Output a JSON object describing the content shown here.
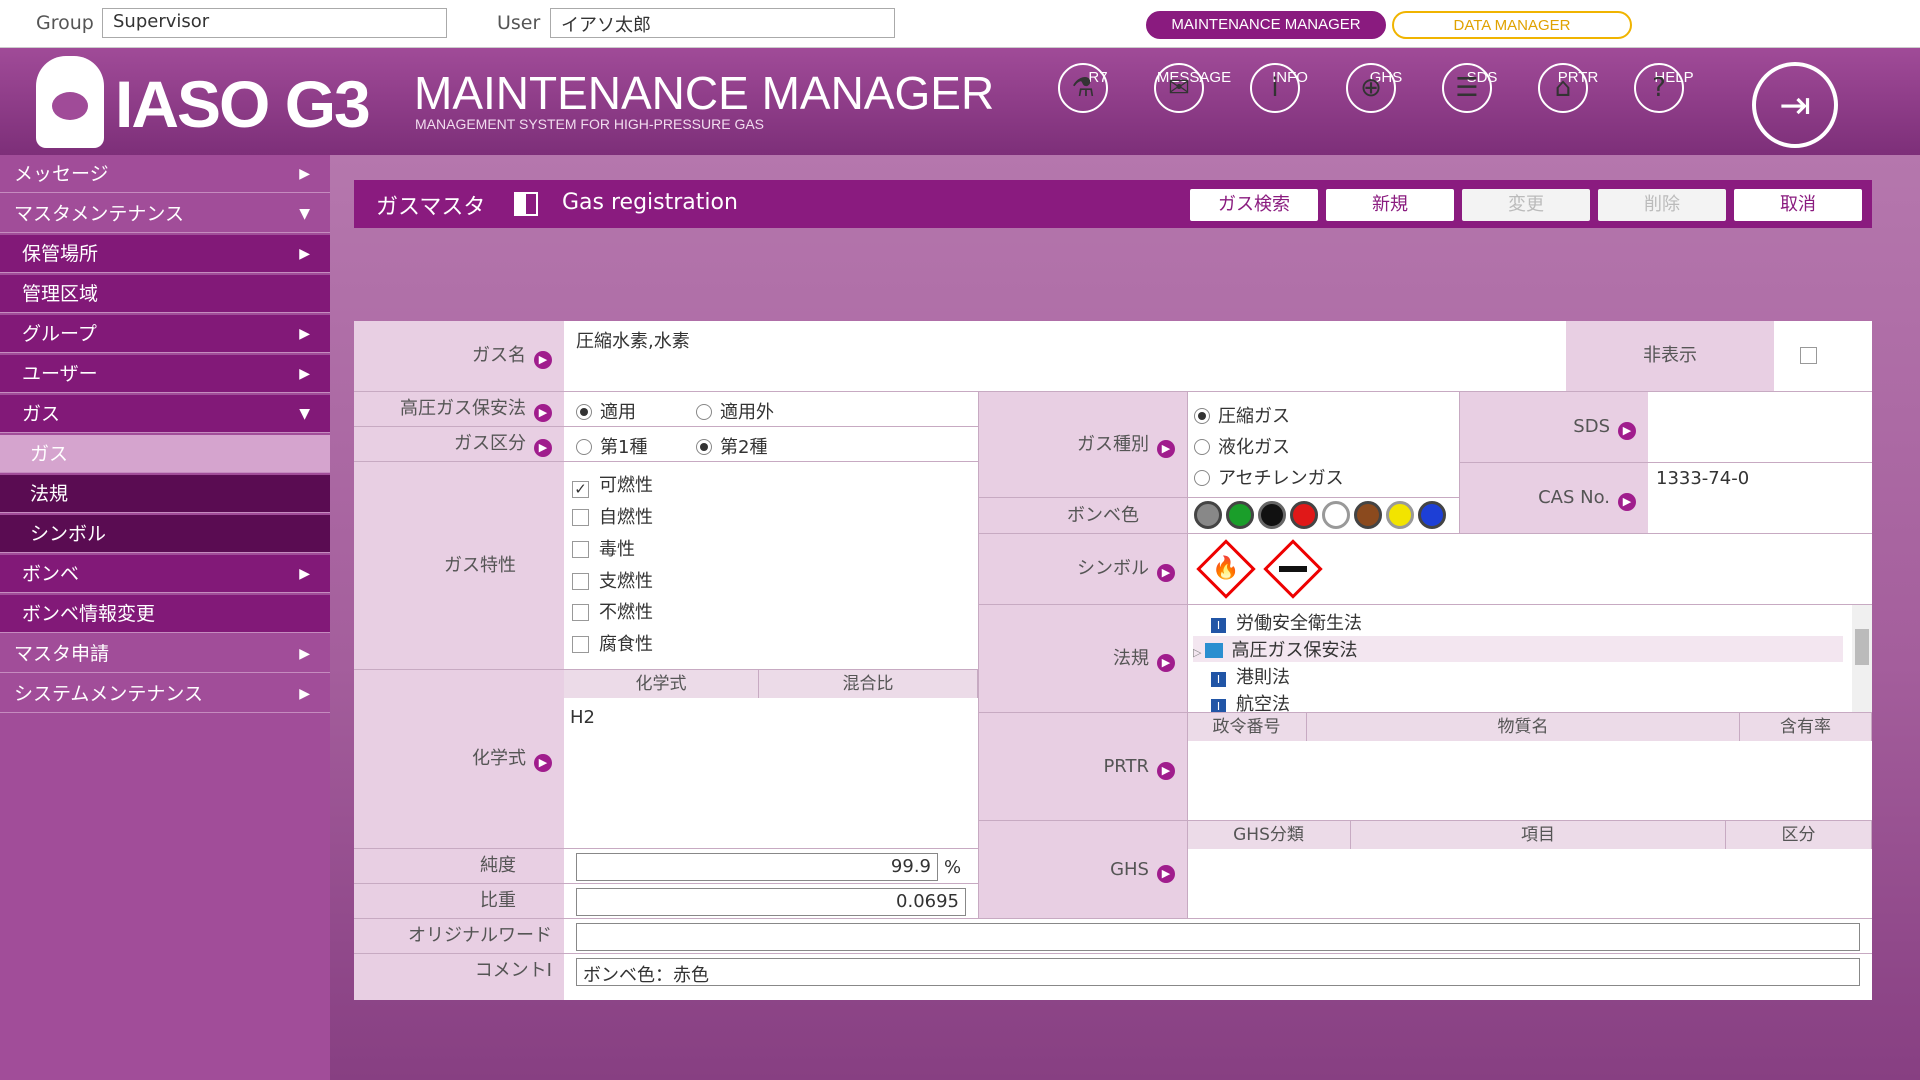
{
  "topbar": {
    "group_label": "Group",
    "group_value": "Supervisor",
    "user_label": "User",
    "user_value": "イアソ太郎",
    "btn_maint": "MAINTENANCE MANAGER",
    "btn_data": "DATA MANAGER"
  },
  "header": {
    "logo": "IASO G3",
    "title": "MAINTENANCE MANAGER",
    "subtitle": "MANAGEMENT SYSTEM FOR HIGH-PRESSURE GAS",
    "nav": [
      {
        "label": "R7",
        "icon": "flask-icon"
      },
      {
        "label": "MESSAGE",
        "icon": "envelope-icon"
      },
      {
        "label": "INFO",
        "icon": "info-icon"
      },
      {
        "label": "GHS",
        "icon": "globe-icon"
      },
      {
        "label": "SDS",
        "icon": "document-icon"
      },
      {
        "label": "PRTR",
        "icon": "factory-icon"
      },
      {
        "label": "HELP",
        "icon": "help-icon"
      }
    ]
  },
  "sidebar": [
    "メッセージ",
    "マスタメンテナンス",
    "保管場所",
    "管理区域",
    "グループ",
    "ユーザー",
    "ガス",
    "ガス",
    "法規",
    "シンボル",
    "ボンベ",
    "ボンベ情報変更",
    "マスタ申請",
    "システムメンテナンス"
  ],
  "page": {
    "title_jp": "ガスマスタ",
    "title_en": "Gas registration",
    "buttons": [
      "ガス検索",
      "新規",
      "変更",
      "削除",
      "取消"
    ]
  },
  "form": {
    "gas_name_label": "ガス名",
    "gas_name": "圧縮水素,水素",
    "hidden_label": "非表示",
    "hp_law_label": "高圧ガス保安法",
    "hp_law_opts": [
      "適用",
      "適用外"
    ],
    "gas_class_label": "ガス区分",
    "gas_class_opts": [
      "第1種",
      "第2種"
    ],
    "gas_type_label": "ガス種別",
    "gas_type_opts": [
      "圧縮ガス",
      "液化ガス",
      "アセチレンガス"
    ],
    "sds_label": "SDS",
    "cas_label": "CAS No.",
    "cas_value": "1333-74-0",
    "props_label": "ガス特性",
    "props": [
      "可燃性",
      "自燃性",
      "毒性",
      "支燃性",
      "不燃性",
      "腐食性"
    ],
    "cyl_color_label": "ボンベ色",
    "cyl_colors": [
      "#888888",
      "#1a9e2a",
      "#111111",
      "#e01818",
      "#ffffff",
      "#8b4a1e",
      "#f2e400",
      "#1d3fd6"
    ],
    "symbol_label": "シンボル",
    "law_label": "法規",
    "laws": [
      "労働安全衛生法",
      "高圧ガス保安法",
      "港則法",
      "航空法"
    ],
    "formula_label": "化学式",
    "formula_h": [
      "化学式",
      "混合比"
    ],
    "formula_value": "H2",
    "prtr_label": "PRTR",
    "prtr_h": [
      "政令番号",
      "物質名",
      "含有率"
    ],
    "ghs_label": "GHS",
    "ghs_h": [
      "GHS分類",
      "項目",
      "区分"
    ],
    "purity_label": "純度",
    "purity": "99.9",
    "purity_unit": "%",
    "sg_label": "比重",
    "sg": "0.0695",
    "orig_label": "オリジナルワード",
    "orig": "",
    "comment_label": "コメントⅠ",
    "comment": "ボンベ色：赤色"
  }
}
